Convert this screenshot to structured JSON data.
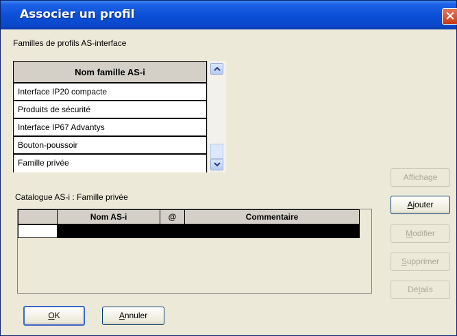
{
  "window": {
    "title": "Associer un profil",
    "close_glyph": "×",
    "accent": "#0b4fd8"
  },
  "families": {
    "section_label": "Familles de profils AS-interface",
    "column_header": "Nom famille AS-i",
    "items": [
      "Interface IP20 compacte",
      "Produits de sécurité",
      "Interface IP67 Advantys",
      "Bouton-poussoir",
      "Famille privée"
    ]
  },
  "catalogue": {
    "section_label": "Catalogue AS-i : Famille privée",
    "columns": [
      "Nom AS-i",
      "@",
      "Commentaire"
    ]
  },
  "side_buttons": {
    "affichage": {
      "label": "Affichage",
      "enabled": false
    },
    "ajouter": {
      "pre": "",
      "key": "A",
      "post": "jouter",
      "enabled": true
    },
    "modifier": {
      "pre": "",
      "key": "M",
      "post": "odifier",
      "enabled": false
    },
    "supprimer": {
      "pre": "",
      "key": "S",
      "post": "upprimer",
      "enabled": false
    },
    "details": {
      "pre": "Dé",
      "key": "t",
      "post": "ails",
      "enabled": false
    }
  },
  "bottom_buttons": {
    "ok": {
      "key": "O",
      "post": "K"
    },
    "annuler": {
      "key": "A",
      "post": "nnuler"
    }
  }
}
